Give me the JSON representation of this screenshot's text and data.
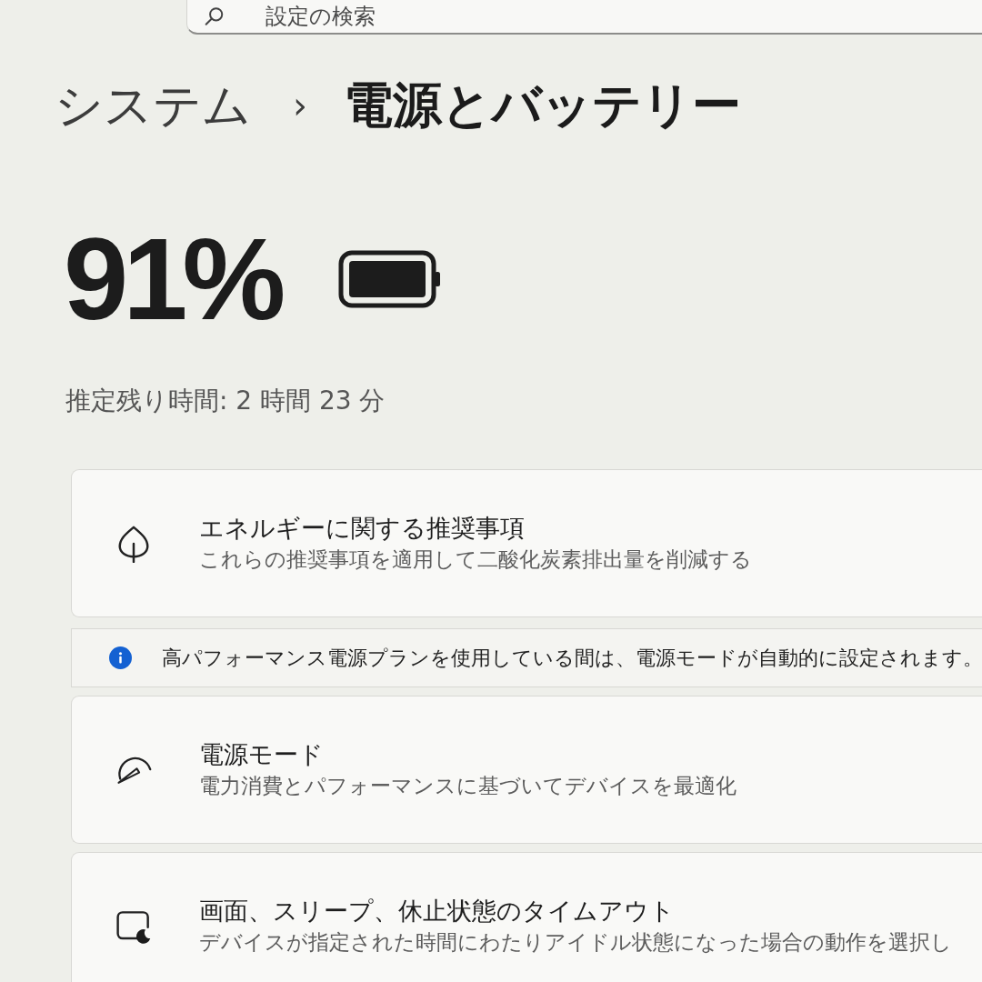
{
  "search": {
    "placeholder": "設定の検索"
  },
  "breadcrumb": {
    "parent": "システム",
    "separator": "›",
    "current": "電源とバッテリー"
  },
  "battery": {
    "percent": "91%",
    "estimate": "推定残り時間: 2 時間 23 分"
  },
  "settings": [
    {
      "kind": "card",
      "title": "エネルギーに関する推奨事項",
      "description": "これらの推奨事項を適用して二酸化炭素排出量を削減する"
    },
    {
      "kind": "info",
      "text": "高パフォーマンス電源プランを使用している間は、電源モードが自動的に設定されます。"
    },
    {
      "kind": "card",
      "title": "電源モード",
      "description": "電力消費とパフォーマンスに基づいてデバイスを最適化"
    },
    {
      "kind": "card",
      "title": "画面、スリープ、休止状態のタイムアウト",
      "description": "デバイスが指定された時間にわたりアイドル状態になった場合の動作を選択し"
    }
  ]
}
